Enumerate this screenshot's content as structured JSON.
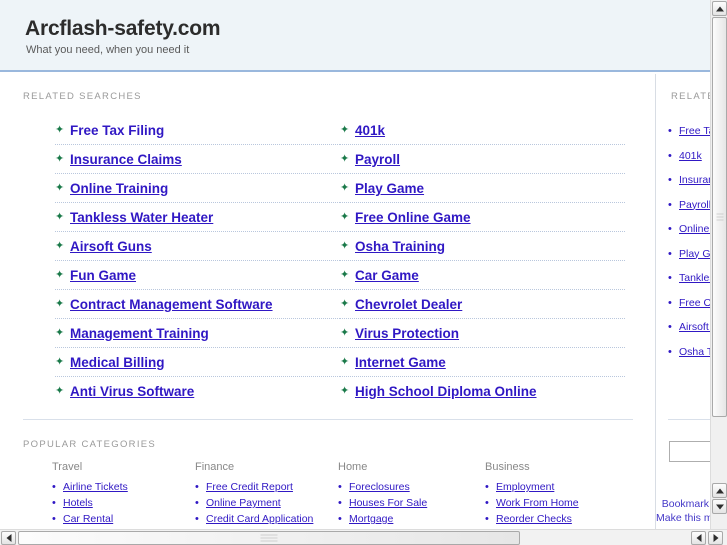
{
  "header": {
    "title": "Arcflash-safety.com",
    "tagline": "What you need, when you need it"
  },
  "main": {
    "related_label": "RELATED SEARCHES",
    "related_left": [
      {
        "label": "Free Tax Filing",
        "underlined": false
      },
      {
        "label": "Insurance Claims",
        "underlined": true
      },
      {
        "label": "Online Training",
        "underlined": true
      },
      {
        "label": "Tankless Water Heater",
        "underlined": true
      },
      {
        "label": "Airsoft Guns",
        "underlined": true
      },
      {
        "label": "Fun Game",
        "underlined": true
      },
      {
        "label": "Contract Management Software",
        "underlined": true
      },
      {
        "label": "Management Training",
        "underlined": true
      },
      {
        "label": "Medical Billing",
        "underlined": true
      },
      {
        "label": "Anti Virus Software",
        "underlined": true
      }
    ],
    "related_right": [
      {
        "label": "401k",
        "underlined": true
      },
      {
        "label": "Payroll",
        "underlined": true
      },
      {
        "label": "Play Game",
        "underlined": true
      },
      {
        "label": "Free Online Game",
        "underlined": true
      },
      {
        "label": "Osha Training",
        "underlined": true
      },
      {
        "label": "Car Game",
        "underlined": true
      },
      {
        "label": "Chevrolet Dealer",
        "underlined": true
      },
      {
        "label": "Virus Protection",
        "underlined": true
      },
      {
        "label": "Internet Game",
        "underlined": true
      },
      {
        "label": "High School Diploma Online",
        "underlined": true
      }
    ],
    "popular_label": "POPULAR CATEGORIES",
    "categories": [
      {
        "heading": "Travel",
        "items": [
          "Airline Tickets",
          "Hotels",
          "Car Rental"
        ]
      },
      {
        "heading": "Finance",
        "items": [
          "Free Credit Report",
          "Online Payment",
          "Credit Card Application"
        ]
      },
      {
        "heading": "Home",
        "items": [
          "Foreclosures",
          "Houses For Sale",
          "Mortgage"
        ]
      },
      {
        "heading": "Business",
        "items": [
          "Employment",
          "Work From Home",
          "Reorder Checks"
        ]
      }
    ]
  },
  "sidebar": {
    "related_label": "RELATED",
    "items": [
      "Free Tax Filing",
      "401k",
      "Insurance Claims",
      "Payroll",
      "Online Training",
      "Play Game",
      "Tankless Water Heater",
      "Free Online Game",
      "Airsoft Guns",
      "Osha Training"
    ],
    "search_value": "",
    "search_placeholder": "",
    "footer_links": [
      "Bookmark",
      "Make this my homepage"
    ]
  },
  "icons": {
    "arrow_bullet": "✦",
    "dot_bullet": "•"
  },
  "colors": {
    "link": "#3018c4",
    "arrow": "#1b7a4a",
    "header_bg": "#eef4f8",
    "header_border": "#9ab8dd",
    "label": "#9a9a9a"
  }
}
